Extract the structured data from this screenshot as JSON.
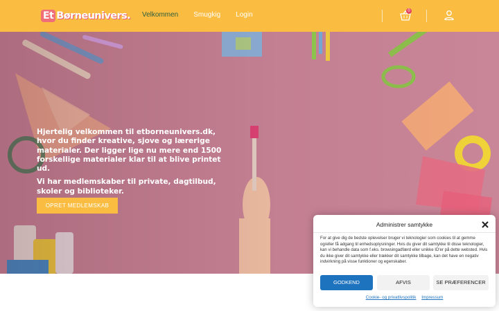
{
  "header": {
    "logo_prefix": "Et",
    "logo_name": "Børneunivers.",
    "nav": [
      {
        "label": "Velkommen",
        "active": true
      },
      {
        "label": "Smugkig",
        "active": false
      },
      {
        "label": "Login",
        "active": false
      }
    ],
    "cart_count": "0",
    "cart_icon": "shopping-basket-icon",
    "user_icon": "user-icon"
  },
  "hero": {
    "paragraph1": "Hjertelig velkommen til etborneunivers.dk, hvor du finder kreative, sjove og lærerige materialer. Der ligger lige nu mere end 1500 forskellige materialer klar til at blive printet ud.",
    "paragraph2": "Vi har medlemskaber til private, dagtilbud, skoler og biblioteker.",
    "cta_label": "OPRET MEDLEMSKAB"
  },
  "consent": {
    "title": "Administrer samtykke",
    "body": "For at give dig de bedste oplevelser bruger vi teknologier som cookies til at gemme og/eller få adgang til enhedsoplysninger. Hvis du giver dit samtykke til disse teknologier, kan vi behandle data som f.eks. browsingadfærd eller unikke ID'er på dette websted. Hvis du ikke giver dit samtykke eller trækker dit samtykke tilbage, kan det have en negativ indvirkning på visse funktioner og egenskaber.",
    "accept_label": "GODKEND",
    "deny_label": "AFVIS",
    "prefs_label": "SE PRÆFERENCER",
    "link_privacy": "Cookie- og privatlivspolitik",
    "link_impressum": "Impressum"
  },
  "colors": {
    "header_bg": "#fbbd41",
    "active_nav": "#2b5c3b",
    "hero_bg": "#c98698",
    "accept_button": "#1e73be"
  }
}
